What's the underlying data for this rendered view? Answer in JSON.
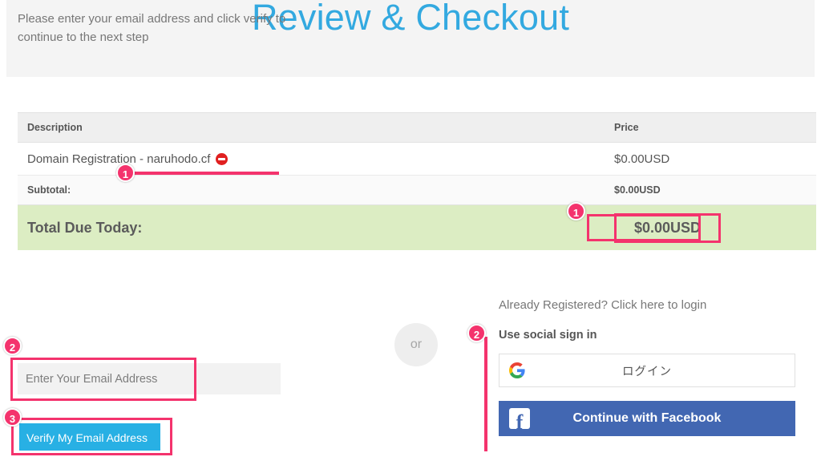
{
  "header": {
    "title": "Review & Checkout"
  },
  "order_table": {
    "columns": [
      "Description",
      "Price"
    ],
    "rows": [
      {
        "type": "item",
        "description": "Domain Registration - naruhodo.cf",
        "remove_icon": "remove-circle-icon",
        "price": "$0.00USD"
      },
      {
        "type": "subtotal",
        "description": "Subtotal:",
        "price": "$0.00USD"
      },
      {
        "type": "total",
        "description": "Total Due Today:",
        "price": "$0.00USD"
      }
    ]
  },
  "email_section": {
    "help_text": "Please enter your email address and click verify to continue to the next step",
    "input_placeholder": "Enter Your Email Address",
    "input_value": "",
    "verify_button": "Verify My Email Address"
  },
  "divider": {
    "label": "or"
  },
  "social_section": {
    "login_prompt": "Already Registered? Click here to login",
    "social_label": "Use social sign in",
    "google_button": "ログイン",
    "google_icon": "google-g-icon",
    "facebook_button": "Continue with Facebook",
    "facebook_icon": "facebook-f-icon"
  },
  "annotations": {
    "markers": [
      {
        "id": "m1a",
        "label": "1"
      },
      {
        "id": "m1b",
        "label": "1"
      },
      {
        "id": "m2a",
        "label": "2"
      },
      {
        "id": "m2b",
        "label": "2"
      },
      {
        "id": "m3",
        "label": "3"
      }
    ],
    "accent_color": "#f4336d"
  },
  "colors": {
    "title_blue": "#33a9e0",
    "banner_gray": "#f4f4f4",
    "total_row_green": "#dcedc3",
    "verify_button_blue": "#28b0e4",
    "facebook_blue": "#4267b2",
    "annotation_pink": "#f4336d",
    "remove_icon_red": "#e02020"
  }
}
